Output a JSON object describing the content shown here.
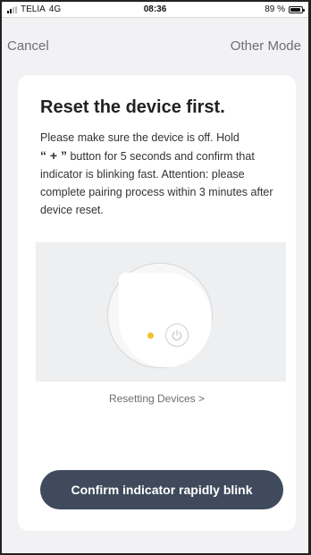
{
  "status_bar": {
    "carrier": "TELIA",
    "network": "4G",
    "time": "08:36",
    "battery_percent": "89 %",
    "battery_level": 0.89
  },
  "nav": {
    "cancel_label": "Cancel",
    "other_mode_label": "Other Mode"
  },
  "card": {
    "title": "Reset the device first.",
    "desc_before": "Please make sure the device is off. Hold",
    "desc_plus": "“ + ”",
    "desc_after": " button for 5 seconds and confirm that indicator is blinking fast. Attention: please complete pairing process within 3 minutes after device reset.",
    "reset_link": "Resetting Devices >",
    "confirm_button": "Confirm indicator rapidly blink"
  },
  "icons": {
    "signal": "signal-icon",
    "battery": "battery-icon",
    "indicator": "led-indicator-icon",
    "power": "power-icon"
  },
  "colors": {
    "button_bg": "#3f4b5c",
    "led": "#f2c230",
    "page_bg": "#f2f2f4"
  }
}
